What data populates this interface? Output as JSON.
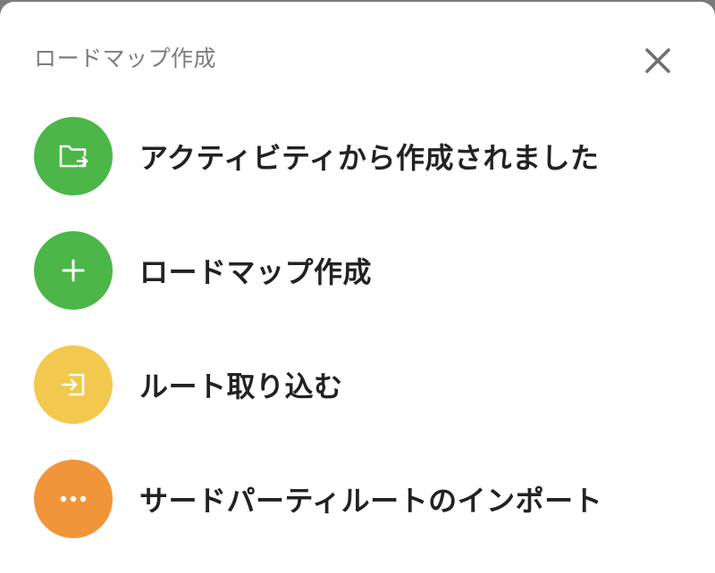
{
  "header": {
    "title": "ロードマップ作成",
    "close_icon": "close-icon"
  },
  "menu": {
    "items": [
      {
        "label": "アクティビティから作成されました",
        "icon": "folder-export-icon",
        "color": "#4cb648"
      },
      {
        "label": "ロードマップ作成",
        "icon": "plus-icon",
        "color": "#4cb648"
      },
      {
        "label": "ルート取り込む",
        "icon": "import-icon",
        "color": "#f2c94c"
      },
      {
        "label": "サードパーティルートのインポート",
        "icon": "more-icon",
        "color": "#f0953a"
      }
    ]
  }
}
